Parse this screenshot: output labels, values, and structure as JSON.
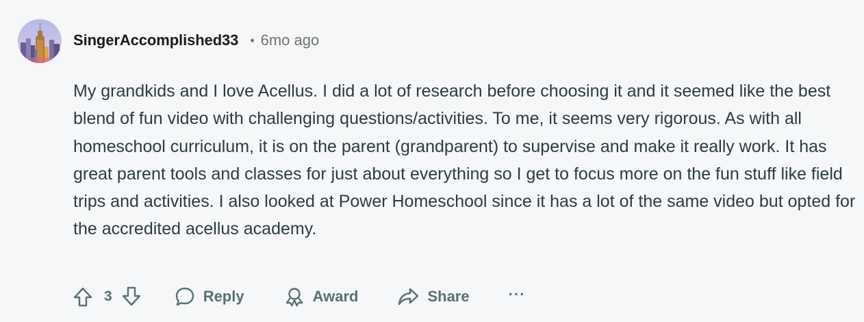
{
  "comment": {
    "avatar_icon": "skyline-avatar-icon",
    "username": "SingerAccomplished33",
    "separator": "•",
    "time": "6mo ago",
    "body": "My grandkids and I love Acellus. I did a lot of research before choosing it and it seemed like the best blend of fun video with challenging questions/activities. To me, it seems very rigorous. As with all homeschool curriculum, it is on the parent (grandparent) to supervise and make it really work. It has great parent tools and classes for just about everything so I get to focus more on the fun stuff like field trips and activities. I also looked at Power Homeschool since it has a lot of the same video but opted for the accredited acellus academy."
  },
  "actions": {
    "upvote_icon": "upvote-arrow-icon",
    "vote_count": "3",
    "downvote_icon": "downvote-arrow-icon",
    "reply_icon": "speech-bubble-icon",
    "reply_label": "Reply",
    "award_icon": "award-ribbon-icon",
    "award_label": "Award",
    "share_icon": "share-arrow-icon",
    "share_label": "Share",
    "more_icon": "more-options-icon",
    "more_label": "···"
  },
  "colors": {
    "background": "#f6f7f8",
    "username": "#1a1a1b",
    "meta": "#6f7274",
    "body_text": "#2a3c42",
    "action": "#576f76"
  }
}
